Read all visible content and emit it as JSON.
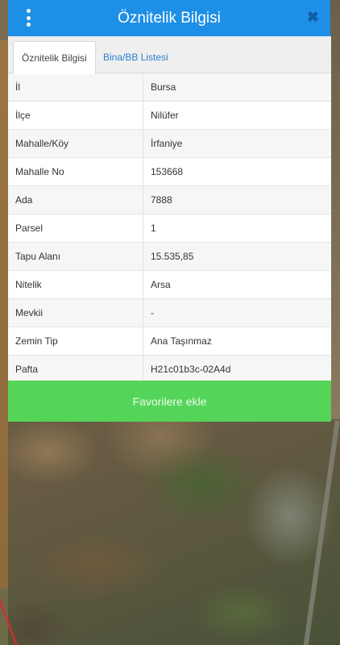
{
  "header": {
    "title": "Öznitelik Bilgisi",
    "close_label": "✖"
  },
  "tabs": [
    {
      "label": "Öznitelik Bilgisi",
      "active": true
    },
    {
      "label": "Bina/BB Listesi",
      "active": false
    }
  ],
  "attributes": [
    {
      "key": "İl",
      "value": "Bursa"
    },
    {
      "key": "İlçe",
      "value": "Nilüfer"
    },
    {
      "key": "Mahalle/Köy",
      "value": "İrfaniye"
    },
    {
      "key": "Mahalle No",
      "value": "153668"
    },
    {
      "key": "Ada",
      "value": "7888"
    },
    {
      "key": "Parsel",
      "value": "1"
    },
    {
      "key": "Tapu Alanı",
      "value": "15.535,85"
    },
    {
      "key": "Nitelik",
      "value": "Arsa"
    },
    {
      "key": "Mevkii",
      "value": "-"
    },
    {
      "key": "Zemin Tip",
      "value": "Ana Taşınmaz"
    },
    {
      "key": "Pafta",
      "value": "H21c01b3c-02A4d"
    }
  ],
  "favorite_button": {
    "label": "Favorilere ekle"
  },
  "colors": {
    "header": "#1e8fe6",
    "favorite": "#55d45a",
    "tab_link": "#2a7fd0"
  },
  "icons": {
    "menu": "more-vertical-icon",
    "close": "close-icon"
  }
}
